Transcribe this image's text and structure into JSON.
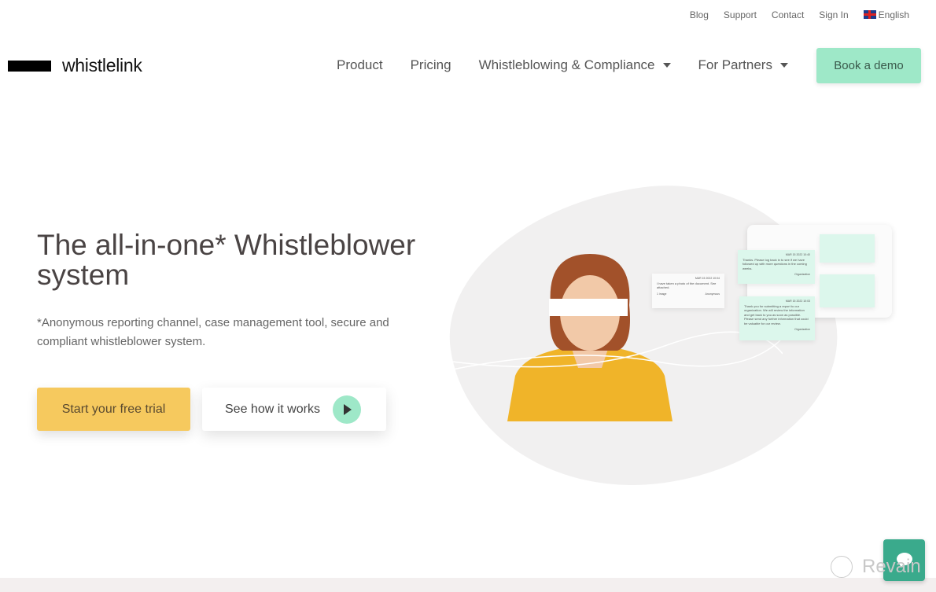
{
  "topbar": {
    "links": [
      "Blog",
      "Support",
      "Contact",
      "Sign In"
    ],
    "language": "English"
  },
  "logo": {
    "text": "whistlelink"
  },
  "nav": {
    "items": [
      "Product",
      "Pricing",
      "Whistleblowing & Compliance",
      "For Partners"
    ],
    "cta": "Book a demo"
  },
  "hero": {
    "title": "The all-in-one* Whistleblower system",
    "subtitle": "*Anonymous reporting channel, case management tool, secure and compliant whistleblower system.",
    "primary_button": "Start your free trial",
    "secondary_button": "See how it works"
  },
  "cards": [
    {
      "date": "MAR 15 2022 10:04",
      "text": "I have taken a photo of the document. See attached.",
      "attachment": "1 image",
      "from": "Anonymous"
    },
    {
      "date": "MAR 15 2022 10:40",
      "text": "Thanks. Please log back in to see if we have followed up with more questions in the coming weeks.",
      "from": "Organization"
    },
    {
      "date": "MAR 15 2022 10:03",
      "text": "Thank you for submitting a report to our organization. We will review the information and get back to you as soon as possible. Please send any further information that could be valuable for our review.",
      "from": "Organization"
    }
  ],
  "watermark": "Revain",
  "colors": {
    "accent": "#9ee8c8",
    "primary_button": "#f6c95e",
    "chat": "#3aaa8c"
  }
}
